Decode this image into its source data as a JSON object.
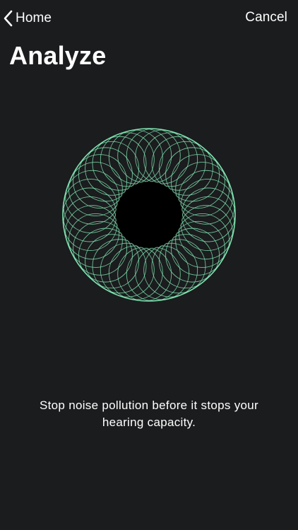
{
  "nav": {
    "back_label": "Home",
    "back_icon": "chevron-left-icon",
    "cancel_label": "Cancel"
  },
  "header": {
    "title": "Analyze"
  },
  "visual": {
    "name": "spirograph-sound-visual",
    "stroke_color": "#7fe3b0",
    "center_color": "#000000"
  },
  "body": {
    "tagline": "Stop noise pollution before it stops your hearing capacity."
  },
  "colors": {
    "background": "#1b1c1e",
    "text": "#ffffff"
  }
}
